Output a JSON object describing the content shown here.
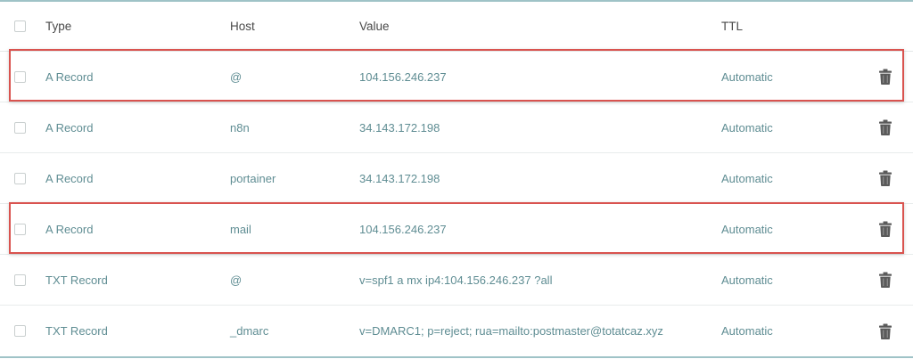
{
  "table": {
    "headers": {
      "type": "Type",
      "host": "Host",
      "value": "Value",
      "ttl": "TTL"
    },
    "rows": [
      {
        "type": "A Record",
        "host": "@",
        "value": "104.156.246.237",
        "ttl": "Automatic",
        "highlighted": true
      },
      {
        "type": "A Record",
        "host": "n8n",
        "value": "34.143.172.198",
        "ttl": "Automatic",
        "highlighted": false
      },
      {
        "type": "A Record",
        "host": "portainer",
        "value": "34.143.172.198",
        "ttl": "Automatic",
        "highlighted": false
      },
      {
        "type": "A Record",
        "host": "mail",
        "value": "104.156.246.237",
        "ttl": "Automatic",
        "highlighted": true
      },
      {
        "type": "TXT Record",
        "host": "@",
        "value": "v=spf1 a mx ip4:104.156.246.237 ?all",
        "ttl": "Automatic",
        "highlighted": false
      },
      {
        "type": "TXT Record",
        "host": "_dmarc",
        "value": "v=DMARC1; p=reject; rua=mailto:postmaster@totatcaz.xyz",
        "ttl": "Automatic",
        "highlighted": false
      }
    ]
  },
  "icons": {
    "checkbox": "checkbox-icon",
    "delete": "trash-icon"
  },
  "colors": {
    "rule": "#9fc3c7",
    "data_text": "#5f8d93",
    "header_text": "#4a4a4a",
    "highlight": "#d9534f",
    "trash": "#5a5a5a"
  }
}
